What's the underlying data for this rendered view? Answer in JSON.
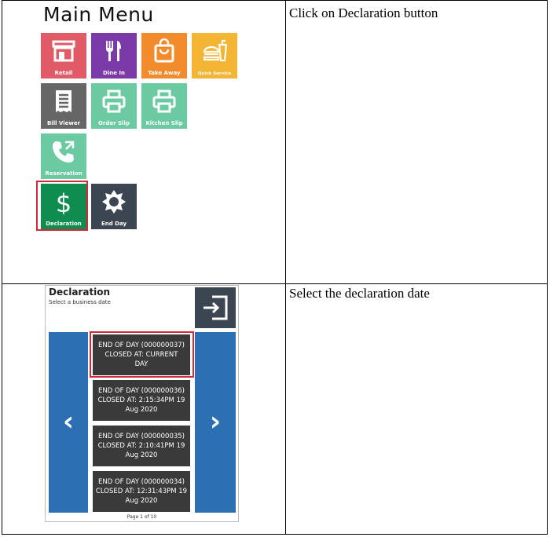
{
  "rows": [
    {
      "instruction": "Click on Declaration button",
      "main_menu": {
        "title": "Main Menu",
        "tiles": [
          {
            "label": "Retail",
            "icon": "store-icon",
            "color": "#e05a67"
          },
          {
            "label": "Dine In",
            "icon": "fork-knife-icon",
            "color": "#7b3aa8"
          },
          {
            "label": "Take Away",
            "icon": "shopping-bag-icon",
            "color": "#f28b2b"
          },
          {
            "label": "Quick Service",
            "icon": "burger-drink-icon",
            "color": "#f3b533"
          },
          {
            "label": "Bill Viewer",
            "icon": "receipt-icon",
            "color": "#666666"
          },
          {
            "label": "Order Slip",
            "icon": "printer-icon",
            "color": "#6ccaa3"
          },
          {
            "label": "Kitchen Slip",
            "icon": "printer-icon",
            "color": "#6ccaa3"
          },
          {
            "label": "Reservation",
            "icon": "phone-icon",
            "color": "#6ccaa3"
          },
          {
            "label": "Declaration",
            "icon": "dollar-icon",
            "color": "#0f8c4f",
            "highlighted": true
          },
          {
            "label": "End Day",
            "icon": "sun-icon",
            "color": "#3c4652"
          }
        ]
      }
    },
    {
      "instruction": "Select the declaration date",
      "declaration": {
        "title": "Declaration",
        "subtitle": "Select a business date",
        "entries": [
          {
            "line1": "END OF DAY (000000037)",
            "line2": "CLOSED AT: CURRENT",
            "line3": "DAY",
            "highlighted": true
          },
          {
            "line1": "END OF DAY (000000036)",
            "line2": "CLOSED AT: 2:15:34PM 19",
            "line3": "Aug 2020"
          },
          {
            "line1": "END OF DAY (000000035)",
            "line2": "CLOSED AT: 2:10:41PM 19",
            "line3": "Aug 2020"
          },
          {
            "line1": "END OF DAY (000000034)",
            "line2": "CLOSED AT: 12:31:43PM 19",
            "line3": "Aug 2020"
          }
        ],
        "prev_glyph": "‹",
        "next_glyph": "›",
        "page_indicator": "Page 1 of 10"
      }
    }
  ],
  "colors": {
    "highlight": "#d42a37",
    "nav_blue": "#2c6fb3",
    "entry_dark": "#3a3a3a"
  }
}
